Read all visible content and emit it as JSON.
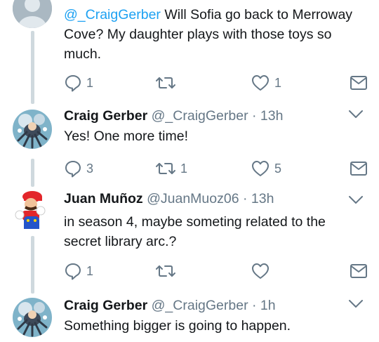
{
  "tweets": [
    {
      "id": "reply-1",
      "mention": "@_CraigGerber",
      "text": " Will Sofia go back to Merroway Cove? My daughter plays with those toys so much.",
      "replies": "1",
      "retweets": "",
      "likes": "1"
    },
    {
      "id": "craig-1",
      "name": "Craig Gerber",
      "handle": "@_CraigGerber",
      "time": "· 13h",
      "text": "Yes! One more time!",
      "replies": "3",
      "retweets": "1",
      "likes": "5"
    },
    {
      "id": "juan-1",
      "name": "Juan Muñoz",
      "handle": "@JuanMuoz06",
      "time": "· 13h",
      "text": "in season 4, maybe someting related to the secret library arc.?",
      "replies": "1",
      "retweets": "",
      "likes": ""
    },
    {
      "id": "craig-2",
      "name": "Craig Gerber",
      "handle": "@_CraigGerber",
      "time": "· 1h",
      "text": "Something bigger is going to happen."
    }
  ],
  "icons": {
    "reply": "reply-icon",
    "retweet": "retweet-icon",
    "like": "heart-icon",
    "dm": "mail-icon",
    "more": "chevron-down-icon"
  },
  "colors": {
    "text": "#14171a",
    "meta": "#657786",
    "link": "#1da1f2",
    "thread_line": "#cfd9de"
  }
}
